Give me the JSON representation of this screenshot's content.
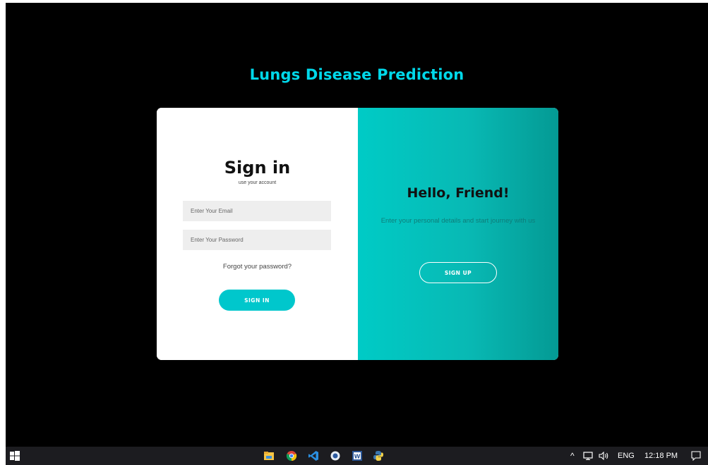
{
  "app": {
    "title": "Lungs Disease Prediction"
  },
  "signin": {
    "title": "Sign in",
    "subtitle": "use your account",
    "email_placeholder": "Enter Your Email",
    "password_placeholder": "Enter Your Password",
    "forgot_label": "Forgot your password?",
    "button_label": "SIGN IN"
  },
  "signup_panel": {
    "title": "Hello, Friend!",
    "text": "Enter your personal details and start journey with us",
    "button_label": "SIGN UP"
  },
  "taskbar": {
    "apps": [
      {
        "name": "file-explorer-icon"
      },
      {
        "name": "chrome-icon"
      },
      {
        "name": "vscode-icon"
      },
      {
        "name": "app-circle-icon"
      },
      {
        "name": "word-icon"
      },
      {
        "name": "python-icon"
      }
    ],
    "tray": {
      "chevron": "^",
      "language": "ENG",
      "time": "12:18 PM"
    }
  },
  "colors": {
    "accent": "#00c7cc",
    "title": "#00d8ea",
    "gradient_start": "#00cbc6",
    "gradient_end": "#049a94"
  }
}
